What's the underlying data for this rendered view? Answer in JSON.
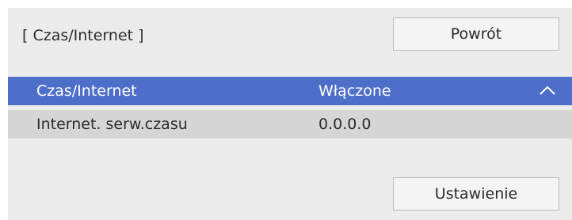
{
  "header": {
    "title": "[ Czas/Internet ]",
    "back_label": "Powrót"
  },
  "settings": {
    "rows": [
      {
        "label": "Czas/Internet",
        "value": "Włączone",
        "selected": true,
        "expanded_icon": "chevron-up-icon"
      },
      {
        "label": "Internet. serw.czasu",
        "value": "0.0.0.0",
        "selected": false
      }
    ]
  },
  "footer": {
    "setting_label": "Ustawienie"
  },
  "colors": {
    "panel_background": "#ececec",
    "selected_row": "#4d6fc9",
    "normal_row": "#d6d6d6",
    "button_background": "#f4f4f4"
  }
}
